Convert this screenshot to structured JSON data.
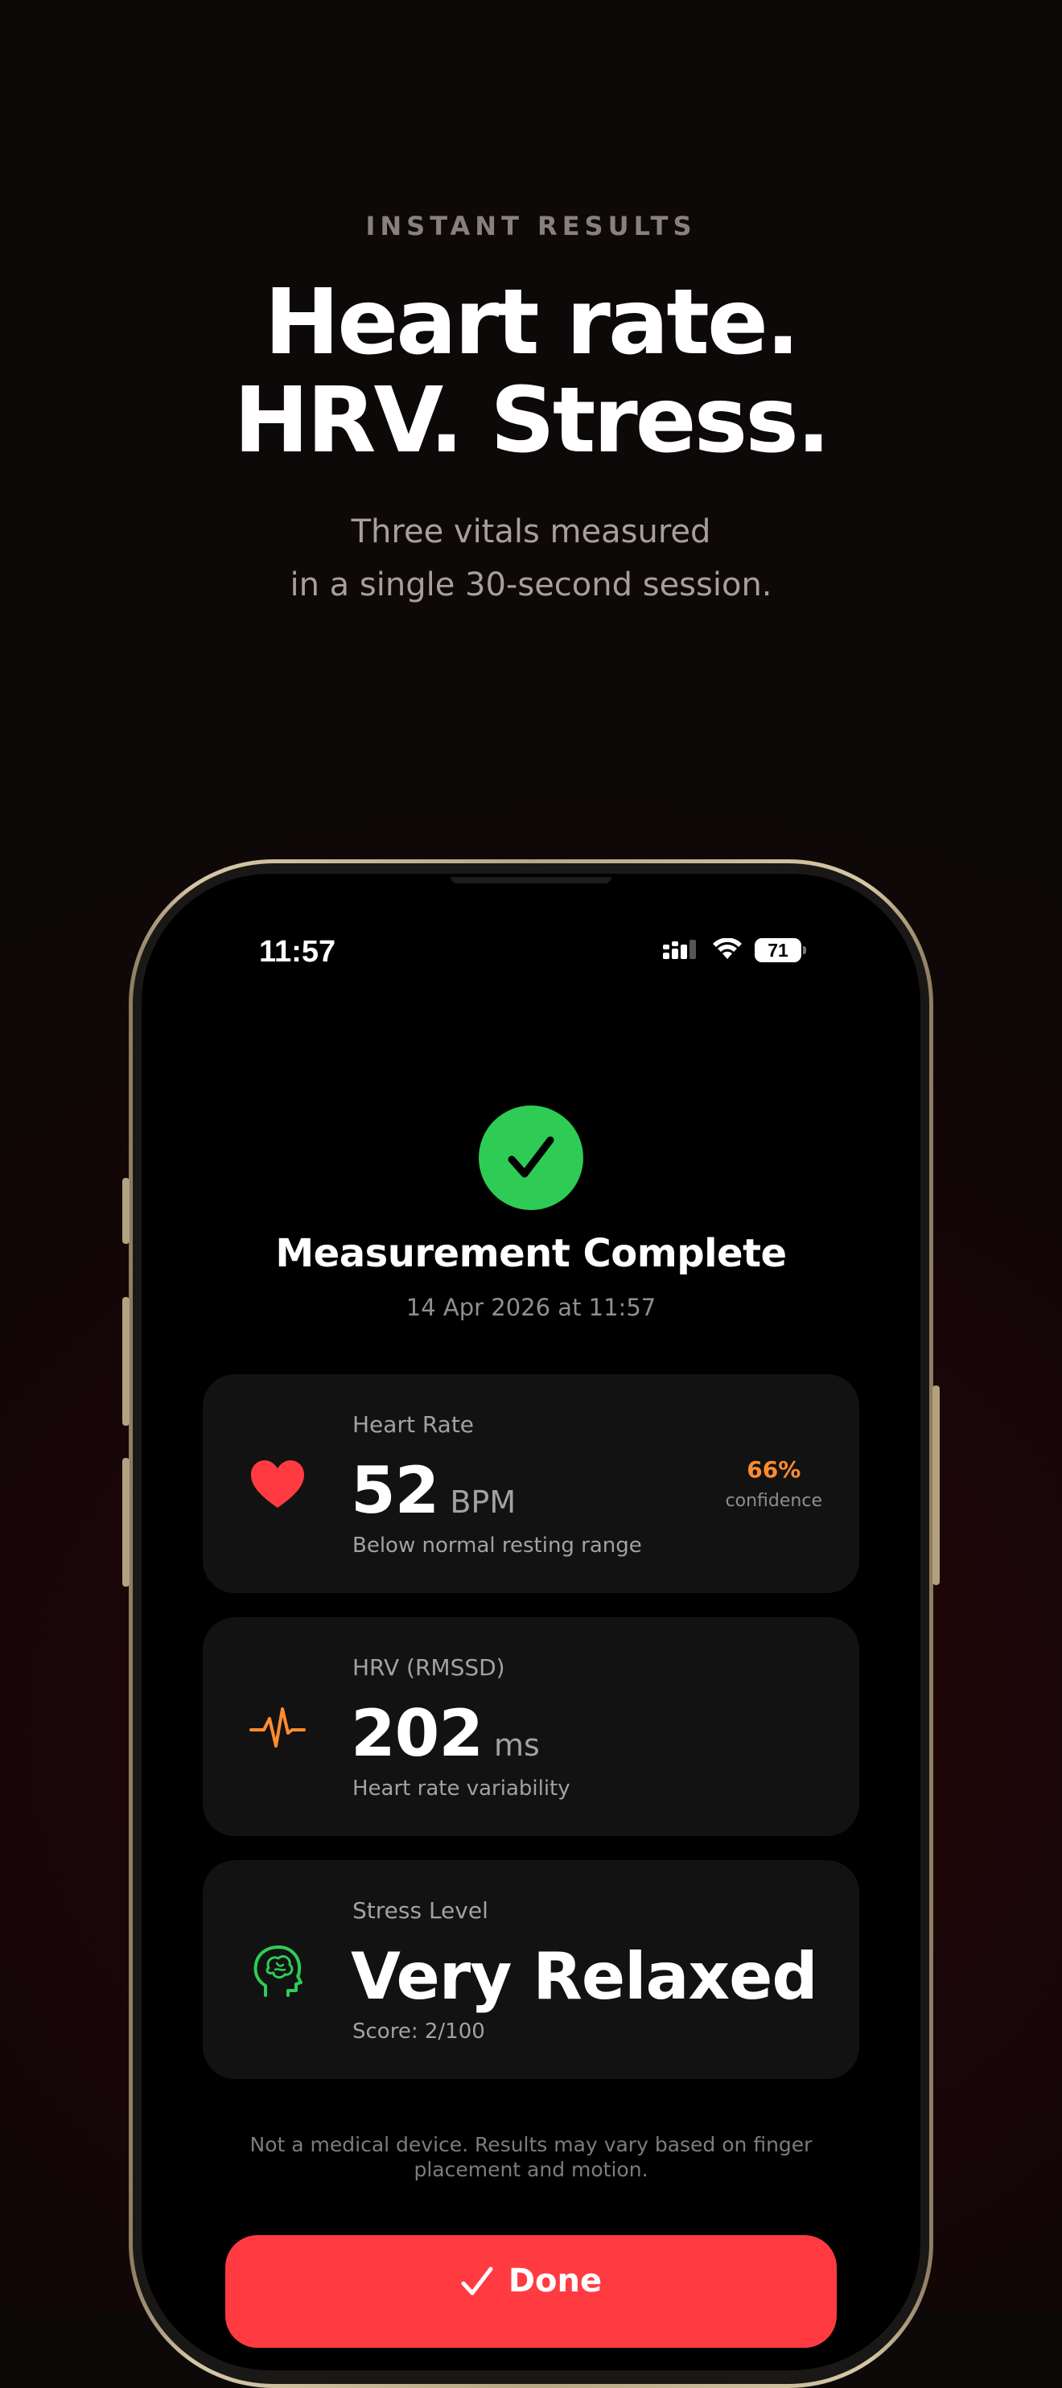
{
  "hero": {
    "eyebrow": "INSTANT RESULTS",
    "headline_line1": "Heart rate.",
    "headline_line2": "HRV. Stress.",
    "subhead_line1": "Three vitals measured",
    "subhead_line2": "in a single 30-second session."
  },
  "status_bar": {
    "time": "11:57",
    "battery": "71",
    "icons": [
      "cellular-signal-icon",
      "wifi-icon",
      "battery-icon"
    ]
  },
  "result": {
    "icon": "checkmark-icon",
    "title": "Measurement Complete",
    "date": "14 Apr 2026 at 11:57"
  },
  "cards": [
    {
      "icon": "heart-icon",
      "label": "Heart Rate",
      "value": "52",
      "unit": "BPM",
      "note": "Below normal resting range",
      "confidence_value": "66%",
      "confidence_label": "confidence"
    },
    {
      "icon": "pulse-wave-icon",
      "label": "HRV (RMSSD)",
      "value": "202",
      "unit": "ms",
      "note": "Heart rate variability"
    },
    {
      "icon": "brain-head-icon",
      "label": "Stress Level",
      "value": "Very Relaxed",
      "note": "Score: 2/100"
    }
  ],
  "disclaimer": "Not a medical device. Results may vary based on finger placement and motion.",
  "done_button": {
    "label": "Done",
    "icon": "checkmark-icon"
  },
  "colors": {
    "accent_red": "#ff3b41",
    "success_green": "#2ecc55",
    "heart_red": "#ff3b41",
    "hrv_orange": "#ff8c2e",
    "stress_green": "#2ecc55",
    "confidence_orange": "#ff8c2e",
    "card_bg": "#121212",
    "screen_bg": "#000000"
  }
}
